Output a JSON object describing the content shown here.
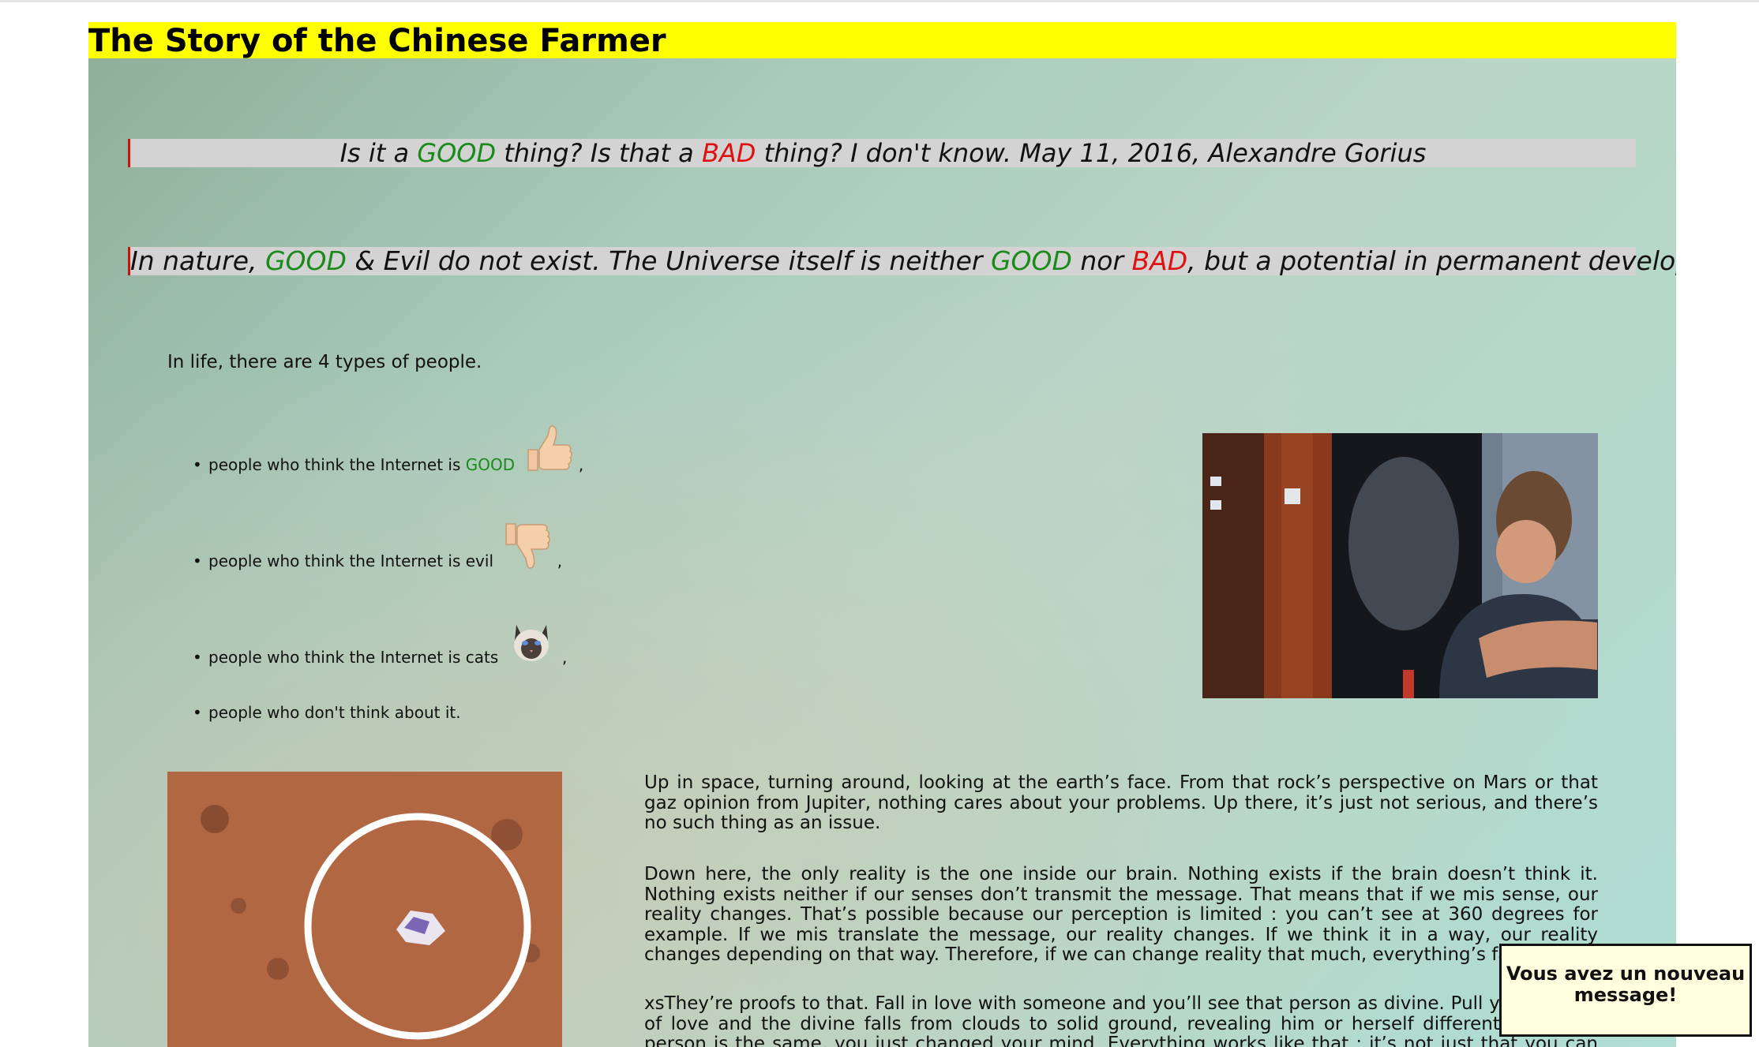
{
  "title": "The Story of the Chinese Farmer",
  "quote1": {
    "p1": "Is it a ",
    "good": "GOOD",
    "p2": " thing? Is that a ",
    "bad": "BAD",
    "p3": " thing? I don't know. May 11, 2016, Alexandre Gorius"
  },
  "quote2": {
    "p1": "In nature, ",
    "good1": "GOOD",
    "p2": " & Evil do not exist. The Universe itself is neither ",
    "good2": "GOOD",
    "p3": " nor ",
    "bad": "BAD",
    "p4": ", but a potential in permanent development."
  },
  "intro": "In life, there are 4 types of people.",
  "list": {
    "item1": {
      "text": "people who think the Internet is ",
      "good": "GOOD",
      "tail": ",",
      "icon": "thumbs-up-icon"
    },
    "item2": {
      "text": "people who think the Internet is evil",
      "tail": ",",
      "icon": "thumbs-down-icon"
    },
    "item3": {
      "text": "people who think the Internet is cats",
      "tail": ",",
      "icon": "cat-icon"
    },
    "item4": {
      "text": "people who don't think about it."
    }
  },
  "paragraphs": {
    "p1": "Up in space, turning around, looking at the earth’s face. From that rock’s perspective on Mars or that gaz opinion from Jupiter, nothing cares about your problems. Up there, it’s just not serious, and there’s no such thing as an issue.",
    "p2": "Down here, the only reality is the one inside our brain. Nothing exists if the brain doesn’t think it. Nothing exists neither if our senses don’t transmit the message. That means that if we mis sense, our reality changes. That’s possible because our perception is limited : you can’t see at 360 degrees for example. If we mis translate the message, our reality changes. If we think it in a way, our reality changes depending on that way. Therefore, if we can change reality that much, everything’s fake.",
    "p3": "xsThey’re proofs to that. Fall in love with someone and you’ll see that person as divine. Pull yourself out of love and the divine falls from clouds to solid ground, revealing him or herself differently. But the person is the same, you just changed your mind. Everything works like that : it’s not just that you can make your world, it’s that you"
  },
  "notification": "Vous avez un nouveau message!",
  "colors": {
    "good": "#1a8a1a",
    "bad": "#e01010",
    "title_bg": "#ffff00",
    "quote_bg": "#d3d3d3",
    "notif_bg": "#ffffe0"
  }
}
